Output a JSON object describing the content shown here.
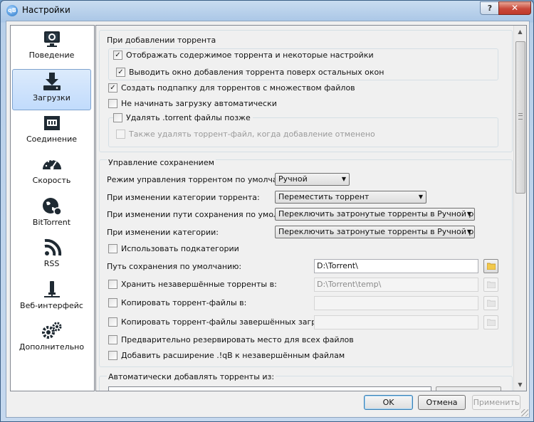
{
  "window": {
    "title": "Настройки",
    "app_icon_text": "qB",
    "help_glyph": "?",
    "close_glyph": "✕"
  },
  "sidebar": {
    "items": [
      {
        "label": "Поведение",
        "icon": "monitor-icon"
      },
      {
        "label": "Загрузки",
        "icon": "download-icon"
      },
      {
        "label": "Соединение",
        "icon": "network-icon"
      },
      {
        "label": "Скорость",
        "icon": "speedometer-icon"
      },
      {
        "label": "BitTorrent",
        "icon": "globe-icon"
      },
      {
        "label": "RSS",
        "icon": "rss-icon"
      },
      {
        "label": "Веб-интерфейс",
        "icon": "web-ui-icon"
      },
      {
        "label": "Дополнительно",
        "icon": "gears-icon"
      }
    ],
    "selected": "Загрузки"
  },
  "adding": {
    "title": "При добавлении торрента",
    "show_content": {
      "label": "Отображать содержимое торрента и некоторые настройки",
      "checked": true
    },
    "dialog_on_top": {
      "label": "Выводить окно добавления торрента поверх остальных окон",
      "checked": true
    },
    "create_subfolder": {
      "label": "Создать подпапку для торрентов с множеством файлов",
      "checked": true
    },
    "dont_start": {
      "label": "Не начинать загрузку автоматически",
      "checked": false
    },
    "delete_torrent": {
      "label": "Удалять .torrent файлы позже",
      "checked": false
    },
    "delete_on_cancel": {
      "label": "Также удалять торрент-файл, когда добавление отменено",
      "checked": false
    }
  },
  "saving": {
    "title": "Управление сохранением",
    "mode_label": "Режим управления торрентом по умолчанию:",
    "mode_value": "Ручной",
    "category_change_label": "При изменении категории торрента:",
    "category_change_value": "Переместить торрент",
    "path_change_label": "При изменении пути сохранения по умолчанию:",
    "path_change_value": "Переключить затронутые торренты в Ручной режим",
    "category_path_label": "При изменении категории:",
    "category_path_value": "Переключить затронутые торренты в Ручной режим",
    "subcategories": {
      "label": "Использовать подкатегории",
      "checked": false
    },
    "default_path_label": "Путь сохранения по умолчанию:",
    "default_path_value": "D:\\Torrent\\",
    "incomplete": {
      "label": "Хранить незавершённые торренты в:",
      "checked": false,
      "value": "D:\\Torrent\\temp\\"
    },
    "copy_torrent": {
      "label": "Копировать торрент-файлы в:",
      "checked": false,
      "value": ""
    },
    "copy_finished": {
      "label": "Копировать торрент-файлы завершённых загрузок в:",
      "checked": false,
      "value": ""
    },
    "preallocate": {
      "label": "Предварительно резервировать место для всех файлов",
      "checked": false
    },
    "append_ext": {
      "label": "Добавить расширение .!qB к незавершённым файлам",
      "checked": false
    }
  },
  "autoadd": {
    "title": "Автоматически добавлять торренты из:"
  },
  "footer": {
    "ok": "OK",
    "cancel": "Отмена",
    "apply": "Применить"
  },
  "colors": {
    "selection": "#c1dbfc",
    "titlebar": "#b7cfe9",
    "close": "#c8483a"
  }
}
